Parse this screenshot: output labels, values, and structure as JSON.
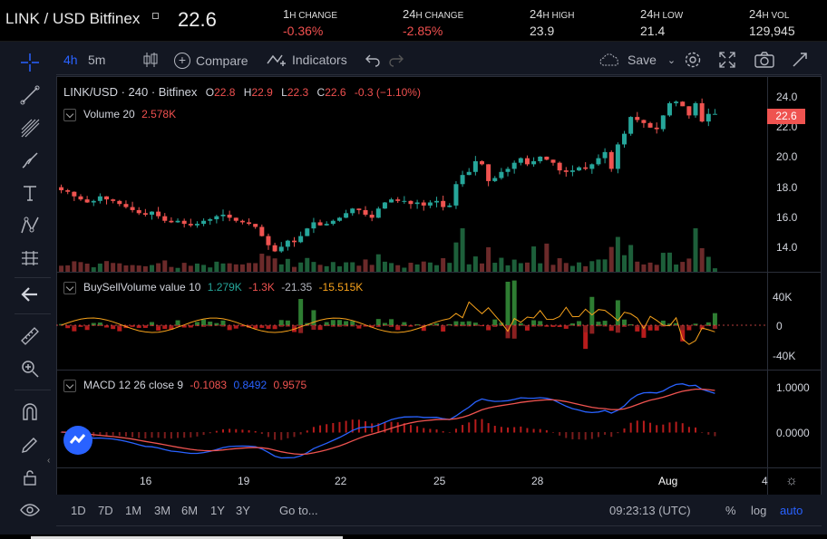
{
  "header": {
    "pair": "LINK / USD Bitfinex",
    "last_price": "22.6",
    "stats": [
      {
        "num": "1",
        "unit": "H CHANGE",
        "value": "-0.36%",
        "negative": true
      },
      {
        "num": "24",
        "unit": "H CHANGE",
        "value": "-2.85%",
        "negative": true
      },
      {
        "num": "24",
        "unit": "H HIGH",
        "value": "23.9",
        "negative": false
      },
      {
        "num": "24",
        "unit": "H LOW",
        "value": "21.4",
        "negative": false
      },
      {
        "num": "24",
        "unit": "H VOL",
        "value": "129,945",
        "negative": false
      }
    ]
  },
  "toolbar": {
    "interval_active": "4h",
    "interval_other": "5m",
    "compare": "Compare",
    "indicators": "Indicators",
    "save": "Save"
  },
  "main_legend": {
    "symbol": "LINK/USD · 240 · Bitfinex",
    "o_label": "O",
    "o_value": "22.8",
    "h_label": "H",
    "h_value": "22.9",
    "l_label": "L",
    "l_value": "22.3",
    "c_label": "C",
    "c_value": "22.6",
    "change": "-0.3 (−1.10%)",
    "volume_label": "Volume 20",
    "volume_value": "2.578K"
  },
  "buysell_legend": {
    "label": "BuySellVolume value 10",
    "v1": "1.279K",
    "v2": "-1.3K",
    "v3": "-21.35",
    "v4": "-15.515K"
  },
  "macd_legend": {
    "label": "MACD 12 26 close 9",
    "v1": "-0.1083",
    "v2": "0.8492",
    "v3": "0.9575"
  },
  "price_axis": [
    "24.0",
    "22.0",
    "20.0",
    "18.0",
    "16.0",
    "14.0"
  ],
  "price_tag": "22.6",
  "bsv_axis": [
    "40K",
    "0",
    "-40K"
  ],
  "macd_axis": [
    "1.0000",
    "0.0000"
  ],
  "x_axis": [
    "16",
    "19",
    "22",
    "25",
    "28",
    "Aug",
    "4"
  ],
  "bottom": {
    "ranges": [
      "1D",
      "7D",
      "1M",
      "3M",
      "6M",
      "1Y",
      "3Y"
    ],
    "goto": "Go to...",
    "time": "09:23:13 (UTC)",
    "pct": "%",
    "log": "log",
    "auto": "auto"
  },
  "colors": {
    "up": "#26a69a",
    "down": "#ef5350",
    "accent": "#2962ff"
  },
  "chart_data": {
    "type": "candlestick",
    "price_series_close": [
      17.6,
      17.5,
      17.2,
      17.0,
      16.8,
      16.9,
      17.2,
      17.0,
      16.9,
      16.7,
      16.5,
      16.3,
      16.1,
      16.0,
      16.2,
      15.9,
      15.6,
      15.5,
      15.6,
      15.4,
      15.3,
      15.4,
      15.6,
      15.7,
      15.9,
      16.0,
      15.8,
      15.6,
      15.5,
      15.4,
      15.2,
      14.6,
      14.0,
      13.6,
      13.9,
      14.3,
      14.2,
      14.6,
      15.1,
      15.5,
      15.3,
      15.4,
      15.6,
      15.8,
      16.1,
      16.4,
      16.3,
      16.0,
      15.8,
      16.4,
      16.8,
      17.0,
      16.9,
      16.9,
      16.7,
      16.8,
      16.6,
      16.8,
      16.9,
      16.5,
      16.6,
      18.0,
      18.6,
      18.8,
      19.5,
      19.3,
      18.2,
      18.4,
      18.8,
      19.0,
      19.4,
      19.7,
      19.3,
      19.5,
      19.8,
      19.6,
      19.4,
      18.9,
      18.8,
      18.9,
      19.1,
      19.0,
      19.3,
      19.7,
      20.1,
      19.0,
      20.6,
      21.3,
      22.4,
      22.2,
      22.0,
      21.7,
      21.6,
      22.5,
      23.3,
      23.4,
      23.1,
      22.5,
      23.3,
      22.1,
      22.6,
      22.6
    ],
    "price_ylim": [
      12.5,
      24.6
    ],
    "buysell_ylim": [
      -50000,
      50000
    ],
    "macd_ylim": [
      -0.4,
      1.2
    ]
  }
}
